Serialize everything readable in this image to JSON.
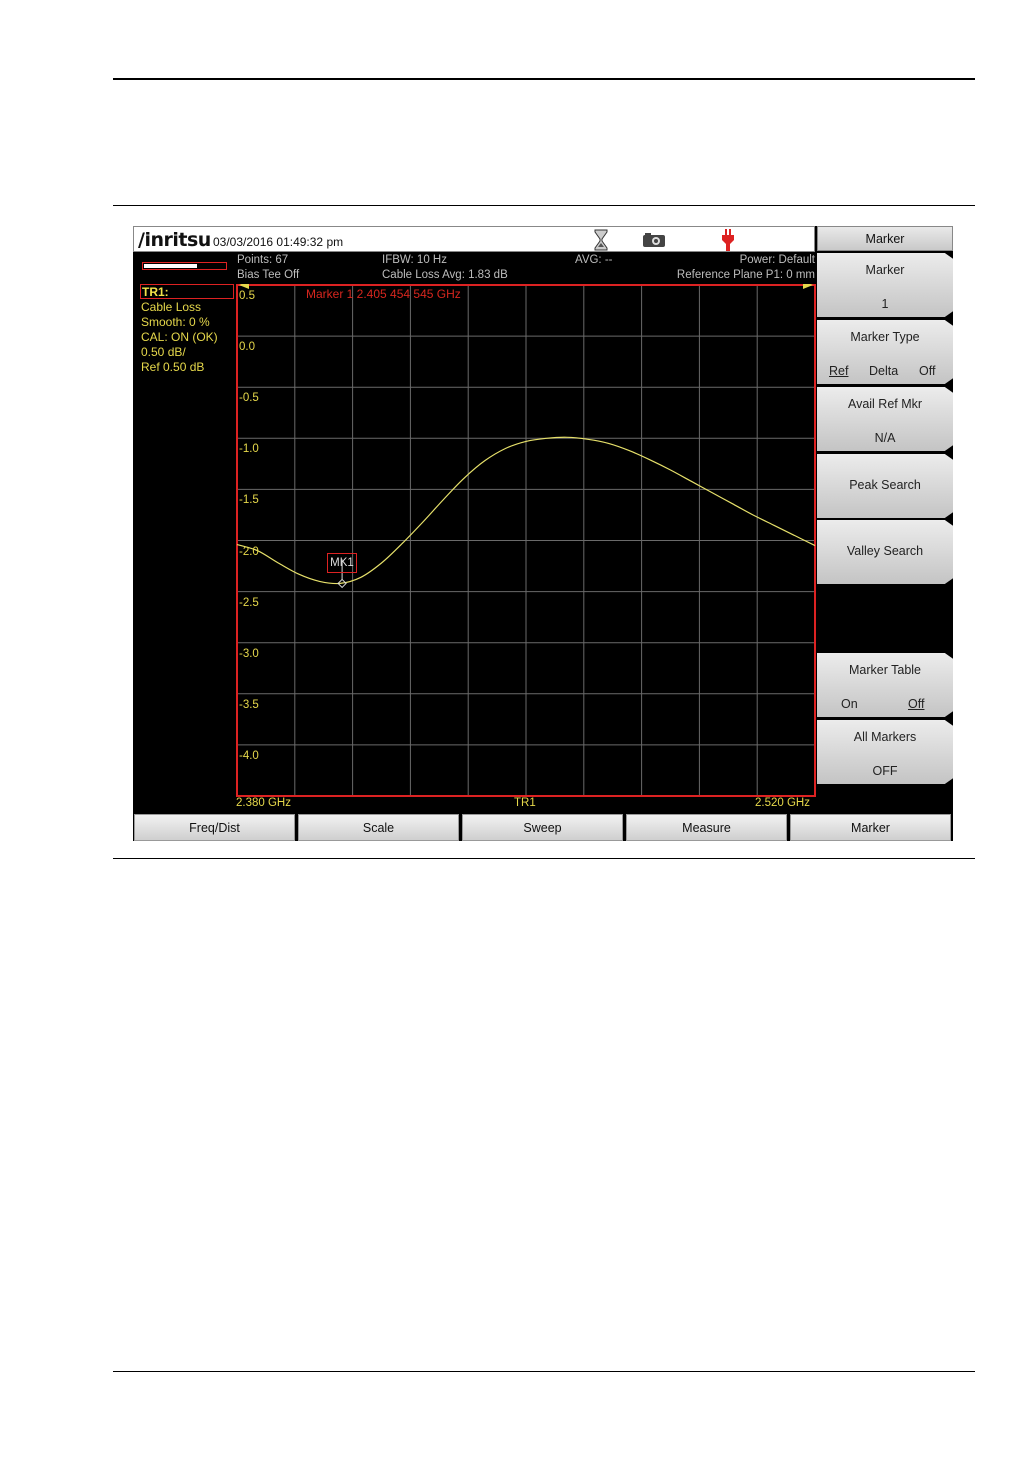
{
  "instrument": {
    "brand": "/inritsu",
    "datetime": "03/03/2016 01:49:32 pm",
    "icons": [
      "hourglass-icon",
      "camera-icon",
      "power-plug-icon"
    ]
  },
  "status": {
    "points": "Points: 67",
    "ifbw": "IFBW: 10 Hz",
    "avg": "AVG: --",
    "power": "Power: Default",
    "bias_tee": "Bias Tee Off",
    "cable_loss_avg": "Cable Loss Avg: 1.83 dB",
    "reference_plane": "Reference Plane P1: 0 mm"
  },
  "progress_fraction": 0.65,
  "trace_info": {
    "title": "TR1:",
    "lines": [
      "Cable Loss",
      "Smooth: 0 %",
      "CAL: ON (OK)",
      "0.50 dB/",
      "Ref 0.50 dB"
    ]
  },
  "marker_readout": "Marker 1 2.405 454 545 GHz",
  "marker_label": "MK1",
  "chart_data": {
    "type": "line",
    "ylim": [
      -4.5,
      0.5
    ],
    "yticks": [
      "0.5",
      "0.0",
      "-0.5",
      "-1.0",
      "-1.5",
      "-2.0",
      "-2.5",
      "-3.0",
      "-3.5",
      "-4.0"
    ],
    "xlim": [
      2.38,
      2.52
    ],
    "x_start_label": "2.380 GHz",
    "x_end_label": "2.520 GHz",
    "trace_label": "TR1",
    "series": [
      {
        "x": [
          2.38,
          2.385,
          2.39,
          2.395,
          2.4,
          2.405,
          2.41,
          2.415,
          2.42,
          2.425,
          2.43,
          2.435,
          2.44,
          2.445,
          2.45,
          2.455,
          2.46,
          2.465,
          2.47,
          2.475,
          2.48,
          2.485,
          2.49,
          2.495,
          2.5,
          2.505,
          2.51,
          2.515,
          2.52
        ],
        "y": [
          -2.04,
          -2.1,
          -2.22,
          -2.33,
          -2.4,
          -2.42,
          -2.36,
          -2.22,
          -2.03,
          -1.82,
          -1.6,
          -1.39,
          -1.22,
          -1.1,
          -1.03,
          -1.0,
          -0.99,
          -1.01,
          -1.05,
          -1.12,
          -1.21,
          -1.31,
          -1.42,
          -1.53,
          -1.64,
          -1.75,
          -1.85,
          -1.95,
          -2.05
        ]
      }
    ],
    "marker": {
      "x": 2.405454545,
      "y": -2.42
    },
    "grid": true
  },
  "soft_keys": {
    "header": "Marker",
    "marker": {
      "label": "Marker",
      "value": "1"
    },
    "marker_type": {
      "label": "Marker Type",
      "options": [
        "Ref",
        "Delta",
        "Off"
      ]
    },
    "avail_ref": {
      "label": "Avail Ref Mkr",
      "value": "N/A"
    },
    "peak_search": "Peak Search",
    "valley_search": "Valley Search",
    "marker_table": {
      "label": "Marker Table",
      "options": [
        "On",
        "Off"
      ]
    },
    "all_markers": {
      "label": "All Markers",
      "value": "OFF"
    }
  },
  "bottom_keys": [
    "Freq/Dist",
    "Scale",
    "Sweep",
    "Measure",
    "Marker"
  ]
}
